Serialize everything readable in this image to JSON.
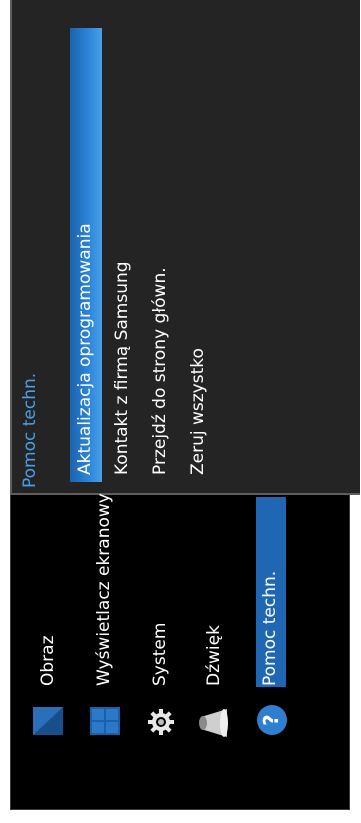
{
  "submenu": {
    "title": "Pomoc techn.",
    "items": [
      {
        "label": "Aktualizacja oprogramowania",
        "selected": true
      },
      {
        "label": "Kontakt z firmą Samsung",
        "selected": false
      },
      {
        "label": "Przejdź do strony główn.",
        "selected": false
      },
      {
        "label": "Zeruj wszystko",
        "selected": false
      }
    ]
  },
  "menu": {
    "items": [
      {
        "label": "Obraz",
        "icon": "picture-icon"
      },
      {
        "label": "Wyświetlacz ekranowy",
        "icon": "onscreen-display-icon"
      },
      {
        "label": "System",
        "icon": "gear-icon"
      },
      {
        "label": "Dźwięk",
        "icon": "speaker-icon"
      },
      {
        "label": "Pomoc techn.",
        "icon": "question-icon",
        "selected": true
      }
    ]
  },
  "colors": {
    "panel_bg": "#000000",
    "submenu_bg": "#242424",
    "highlight": "#1e6fbf",
    "title_blue": "#4a9fe8"
  }
}
